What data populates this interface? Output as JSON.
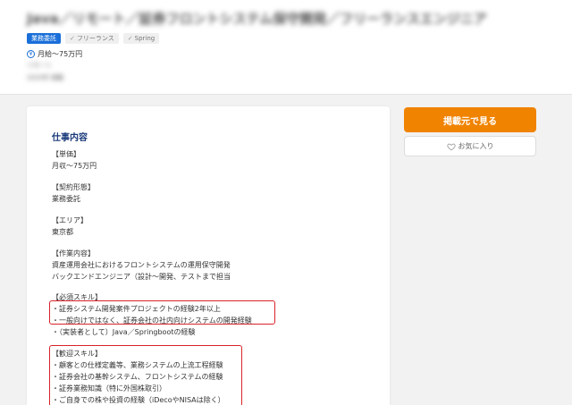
{
  "header": {
    "title": "Java／リモート／証券フロントシステム保守開発／フリーランスエンジニア",
    "tags": [
      {
        "label": "業務委託"
      },
      {
        "label": "フリーランス"
      },
      {
        "label": "Spring"
      }
    ],
    "salary": "月給～75万円",
    "meta_line_1": "リモート",
    "meta_line_2": "2024年 掲載"
  },
  "actions": {
    "view_source": "掲載元で見る",
    "favorite": "お気に入り"
  },
  "job": {
    "section_title": "仕事内容",
    "lines": [
      "【単価】",
      "月収～75万円",
      "",
      "【契約形態】",
      "業務委託",
      "",
      "【エリア】",
      "東京都",
      "",
      "【作業内容】",
      "資産運用会社におけるフロントシステムの運用保守開発",
      "バックエンドエンジニア（設計～開発、テストまで担当",
      "",
      "【必須スキル】",
      "・証券システム開発案件プロジェクトの経験2年以上",
      "・一般向けではなく、証券会社の社内向けシステムの開発経験",
      "・（実装者として）Java／Springbootの経験",
      "",
      "【歓迎スキル】",
      "・顧客との仕様定義等、業務システムの上流工程経験",
      "・証券会社の基幹システム、フロントシステムの経験",
      "・証券業務知識（特に外国株取引）",
      "・ご自身での株や投資の経験（iDecoやNISAは除く）"
    ]
  },
  "colors": {
    "accent": "#1a6fd9",
    "primary_button": "#f08300",
    "highlight": "#d8232a",
    "heading": "#1a3a7a"
  }
}
